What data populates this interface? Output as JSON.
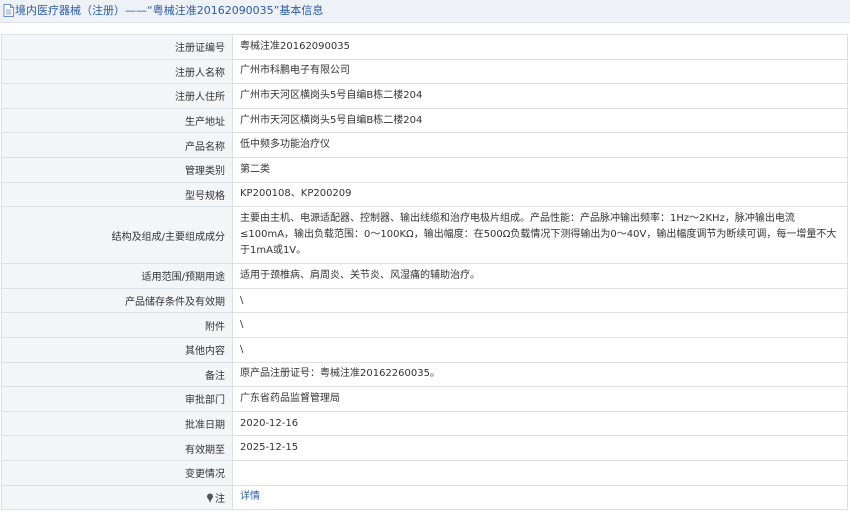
{
  "header": {
    "title": "境内医疗器械（注册）——“粤械注准20162090035”基本信息"
  },
  "rows": [
    {
      "label": "注册证编号",
      "value": "粤械注准20162090035"
    },
    {
      "label": "注册人名称",
      "value": "广州市科鹏电子有限公司"
    },
    {
      "label": "注册人住所",
      "value": "广州市天河区横岗头5号自编B栋二楼204"
    },
    {
      "label": "生产地址",
      "value": "广州市天河区横岗头5号自编B栋二楼204"
    },
    {
      "label": "产品名称",
      "value": "低中频多功能治疗仪"
    },
    {
      "label": "管理类别",
      "value": "第二类"
    },
    {
      "label": "型号规格",
      "value": "KP200108、KP200209"
    },
    {
      "label": "结构及组成/主要组成成分",
      "value": "主要由主机、电源适配器、控制器、输出线缆和治疗电极片组成。产品性能：产品脉冲输出频率：1Hz～2KHz，脉冲输出电流≤100mA，输出负载范围：0～100KΩ，输出幅度：在500Ω负载情况下测得输出为0～40V，输出幅度调节为断续可调，每一增量不大于1mA或1V。"
    },
    {
      "label": "适用范围/预期用途",
      "value": "适用于颈椎病、肩周炎、关节炎、风湿痛的辅助治疗。"
    },
    {
      "label": "产品储存条件及有效期",
      "value": "\\"
    },
    {
      "label": "附件",
      "value": "\\"
    },
    {
      "label": "其他内容",
      "value": "\\"
    },
    {
      "label": "备注",
      "value": "原产品注册证号：粤械注准20162260035。"
    },
    {
      "label": "审批部门",
      "value": "广东省药品监督管理局"
    },
    {
      "label": "批准日期",
      "value": "2020-12-16"
    },
    {
      "label": "有效期至",
      "value": "2025-12-15"
    },
    {
      "label": "变更情况",
      "value": ""
    },
    {
      "label": "注",
      "value": "详情"
    }
  ],
  "colors": {
    "header_bg": "#eef1f6",
    "title_text": "#2a5da8",
    "label_bg": "#f4f5f7",
    "border": "#dde1e6",
    "link": "#2a5da8"
  },
  "icons": {
    "header": "document-icon",
    "note": "pin-icon"
  }
}
